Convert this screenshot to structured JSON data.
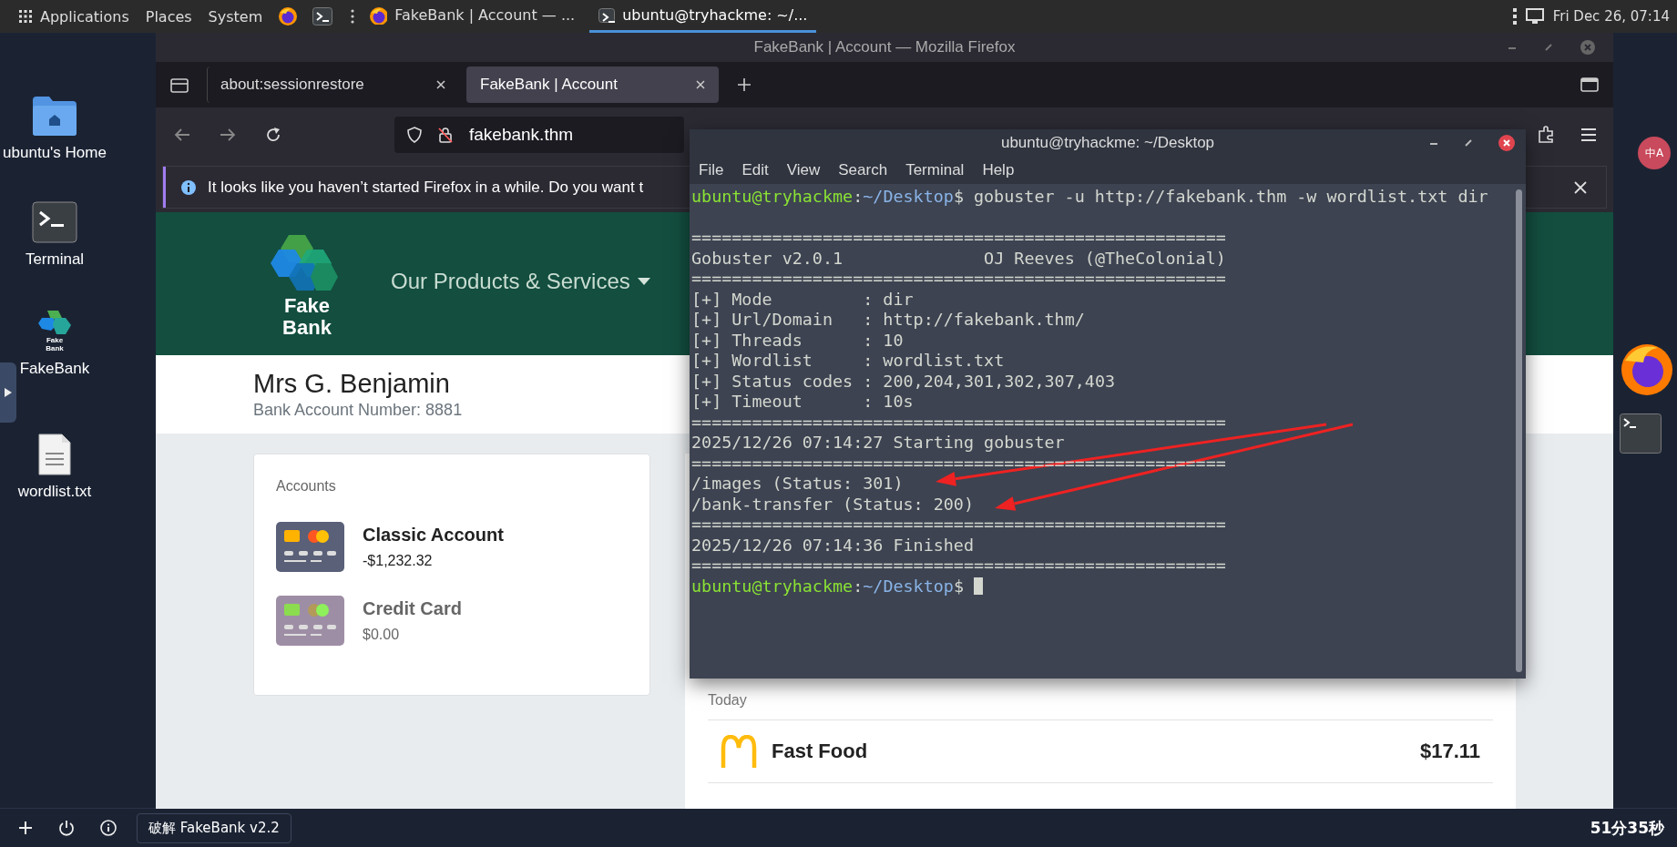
{
  "top_panel": {
    "menus": [
      "Applications",
      "Places",
      "System"
    ],
    "tasks": [
      {
        "label": "FakeBank | Account — ...",
        "kind": "browser",
        "selected": false
      },
      {
        "label": "ubuntu@tryhackme: ~/...",
        "kind": "terminal",
        "selected": true
      }
    ],
    "clock": "Fri Dec 26, 07:14"
  },
  "desktop_icons": [
    {
      "label": "ubuntu's Home",
      "kind": "folder"
    },
    {
      "label": "Terminal",
      "kind": "terminal"
    },
    {
      "label": "FakeBank",
      "kind": "app",
      "badge": "Fake Bank"
    },
    {
      "label": "wordlist.txt",
      "kind": "file"
    }
  ],
  "firefox": {
    "title": "FakeBank | Account — Mozilla Firefox",
    "tabs": [
      {
        "label": "about:sessionrestore",
        "selected": false
      },
      {
        "label": "FakeBank | Account",
        "selected": true
      }
    ],
    "url": "fakebank.thm",
    "notification": "It looks like you haven’t started Firefox in a while. Do you want t",
    "page": {
      "logo_text": "Fake Bank",
      "nav": "Our Products & Services",
      "customer_name": "Mrs G. Benjamin",
      "account_number": "Bank Account Number: 8881",
      "accounts": {
        "title": "Accounts",
        "items": [
          {
            "name": "Classic Account",
            "balance": "-$1,232.32",
            "color": "#5a6078",
            "selected": true
          },
          {
            "name": "Credit Card",
            "balance": "$0.00",
            "color": "#9e8ea5",
            "selected": false
          }
        ]
      },
      "transactions": {
        "heading": "Today",
        "items": [
          {
            "merchant": "Fast Food",
            "amount": "$17.11"
          }
        ]
      }
    }
  },
  "terminal": {
    "title": "ubuntu@tryhackme: ~/Desktop",
    "menu": [
      "File",
      "Edit",
      "View",
      "Search",
      "Terminal",
      "Help"
    ],
    "lines": [
      {
        "kind": "prompt",
        "user": "ubuntu@tryhackme",
        "separator": ":",
        "path": "~/Desktop",
        "symbol": "$",
        "command": "gobuster -u http://fakebank.thm -w wordlist.txt dir",
        "cursor": false
      },
      {
        "kind": "blank"
      },
      {
        "kind": "text",
        "text": "====================================================="
      },
      {
        "kind": "text",
        "text": "Gobuster v2.0.1              OJ Reeves (@TheColonial)"
      },
      {
        "kind": "text",
        "text": "====================================================="
      },
      {
        "kind": "text",
        "text": "[+] Mode         : dir"
      },
      {
        "kind": "text",
        "text": "[+] Url/Domain   : http://fakebank.thm/"
      },
      {
        "kind": "text",
        "text": "[+] Threads      : 10"
      },
      {
        "kind": "text",
        "text": "[+] Wordlist     : wordlist.txt"
      },
      {
        "kind": "text",
        "text": "[+] Status codes : 200,204,301,302,307,403"
      },
      {
        "kind": "text",
        "text": "[+] Timeout      : 10s"
      },
      {
        "kind": "text",
        "text": "====================================================="
      },
      {
        "kind": "text",
        "text": "2025/12/26 07:14:27 Starting gobuster"
      },
      {
        "kind": "text",
        "text": "====================================================="
      },
      {
        "kind": "text",
        "text": "/images (Status: 301)"
      },
      {
        "kind": "text",
        "text": "/bank-transfer (Status: 200)"
      },
      {
        "kind": "text",
        "text": "====================================================="
      },
      {
        "kind": "text",
        "text": "2025/12/26 07:14:36 Finished"
      },
      {
        "kind": "text",
        "text": "====================================================="
      },
      {
        "kind": "prompt",
        "user": "ubuntu@tryhackme",
        "separator": ":",
        "path": "~/Desktop",
        "symbol": "$",
        "cursor": true
      }
    ]
  },
  "translate_badge": "中A",
  "taskbar": {
    "button": "破解 FakeBank v2.2",
    "timer": "51分35秒"
  }
}
